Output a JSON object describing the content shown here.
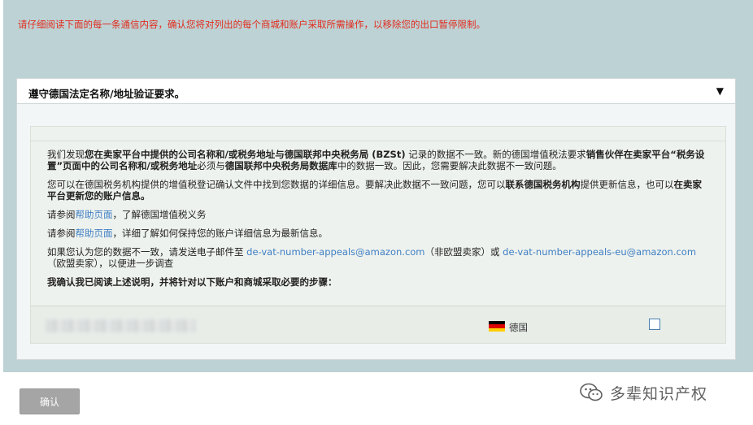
{
  "notice": "请仔细阅读下面的每一条通信内容，确认您将对列出的每个商城和账户采取所需操作，以移除您的出口暂停限制。",
  "panel": {
    "title": "遵守德国法定名称/地址验证要求。",
    "caret": "▼"
  },
  "body": {
    "p1_a": "我们发现",
    "p1_b": "您在卖家平台中提供的公司名称和/或税务地址与德国联邦中央税务局 (BZSt)",
    "p1_c": " 记录的数据不一致。新的德国增值税法要求",
    "p1_d": "销售伙伴在卖家平台“税务设置”页面中的公司名称和/或税务地址",
    "p1_e": "必须与",
    "p1_f": "德国联邦中央税务局数据库",
    "p1_g": "中的数据一致。因此，您需要解决此数据不一致问题。",
    "p2_a": "您可以在德国税务机构提供的增值税登记确认文件中找到您数据的详细信息。要解决此数据不一致问题，您可以",
    "p2_b": "联系德国税务机构",
    "p2_c": "提供更新信息，也可以",
    "p2_d": "在卖家平台更新您的账户信息。",
    "p3_a": "请参阅",
    "p3_link": "帮助页面",
    "p3_b": "，了解德国增值税义务",
    "p4_a": "请参阅",
    "p4_link": "帮助页面",
    "p4_b": "，详细了解如何保持您的账户详细信息为最新信息。",
    "p5_a": "如果您认为您的数据不一致，请发送电子邮件至 ",
    "p5_email1": "de-vat-number-appeals@amazon.com",
    "p5_b": "（非欧盟卖家）或 ",
    "p5_email2": "de-vat-number-appeals-eu@amazon.com",
    "p5_c": "（欧盟卖家），以便进一步调查",
    "confirm": "我确认我已阅读上述说明，并将针对以下账户和商城采取必要的步骤："
  },
  "row": {
    "country": "德国",
    "flag_colors": [
      "#000000",
      "#dd0000",
      "#ffce00"
    ]
  },
  "confirm_button": "确认",
  "watermark": "多辈知识产权",
  "colors": {
    "notice": "#e22b1c",
    "link": "#3f7fc4",
    "frame": "#bcd2d5",
    "button": "#a5a5a5"
  }
}
